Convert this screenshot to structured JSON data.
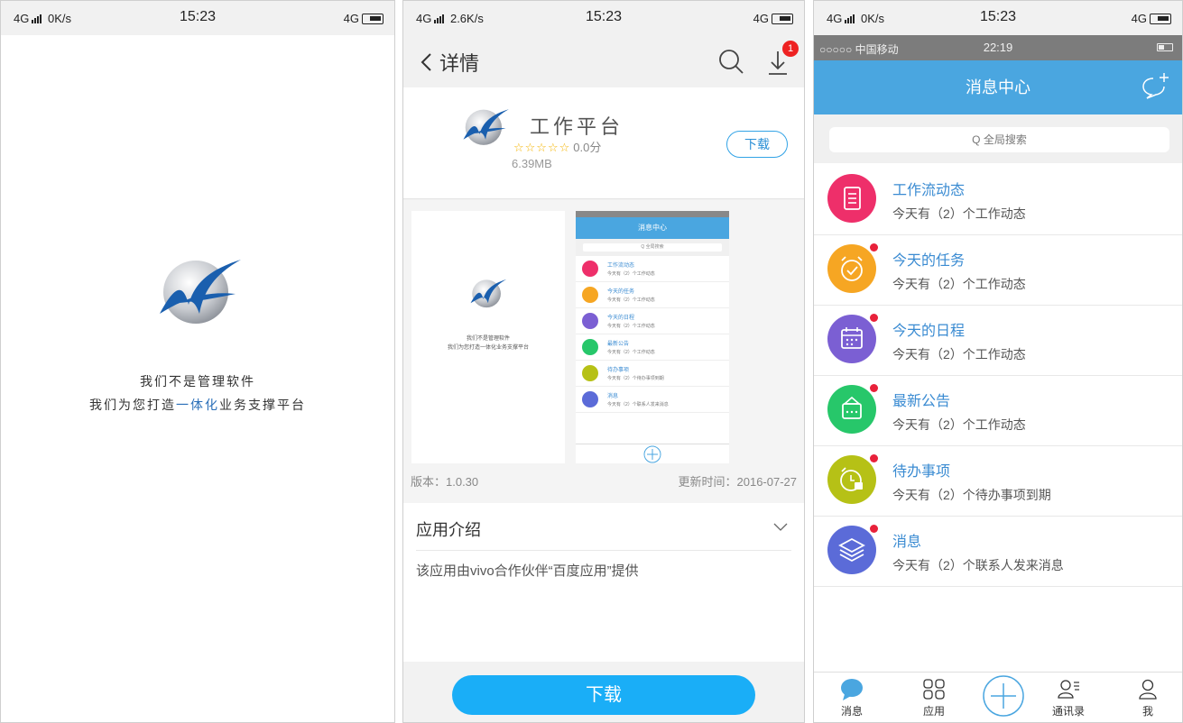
{
  "panel1": {
    "status": {
      "network": "4G",
      "speed": "0K/s",
      "time": "15:23",
      "right_net": "4G"
    },
    "slogan_line1": "我们不是管理软件",
    "slogan_line2_pre": "我们为您打造",
    "slogan_line2_hl": "一体化",
    "slogan_line2_post": "业务支撑平台"
  },
  "panel2": {
    "status": {
      "network": "4G",
      "speed": "2.6K/s",
      "time": "15:23",
      "right_net": "4G"
    },
    "header": {
      "title": "详情",
      "badge": "1"
    },
    "app": {
      "name": "工作平台",
      "stars": "☆☆☆☆☆",
      "rating": "0.0分",
      "size": "6.39MB",
      "download_label": "下载"
    },
    "screenshot_mini": {
      "title": "消息中心",
      "search": "Q 全局搜索",
      "rows": [
        {
          "title": "工作流动态",
          "sub": "今天有（2）个工作动态",
          "color": "#ee2f6a"
        },
        {
          "title": "今天的任务",
          "sub": "今天有（2）个工作动态",
          "color": "#f6a623"
        },
        {
          "title": "今天的日程",
          "sub": "今天有（2）个工作动态",
          "color": "#7b5fd3"
        },
        {
          "title": "最新公告",
          "sub": "今天有（2）个工作动态",
          "color": "#27c76a"
        },
        {
          "title": "待办事项",
          "sub": "今天有（2）个待办事项到期",
          "color": "#b6c116"
        },
        {
          "title": "消息",
          "sub": "今天有（2）个联系人发来消息",
          "color": "#5b6bd8"
        }
      ],
      "slogan_line1": "我们不是管理软件",
      "slogan_line2": "我们为您打造一体化业务支撑平台"
    },
    "version": "版本：1.0.30",
    "updated": "更新时间：2016-07-27",
    "intro_title": "应用介绍",
    "intro_text": "该应用由vivo合作伙伴“百度应用”提供",
    "download_big": "下载"
  },
  "panel3": {
    "status": {
      "network": "4G",
      "speed": "0K/s",
      "time": "15:23",
      "right_net": "4G"
    },
    "ios_status": {
      "carrier": "○○○○○ 中国移动",
      "time": "22:19"
    },
    "header_title": "消息中心",
    "search_placeholder": "Q 全局搜索",
    "items": [
      {
        "title": "工作流动态",
        "sub": "今天有（2）个工作动态",
        "color": "#ee2f6a",
        "icon": "document-icon",
        "dot": false
      },
      {
        "title": "今天的任务",
        "sub": "今天有（2）个工作动态",
        "color": "#f6a623",
        "icon": "alarm-check-icon",
        "dot": true
      },
      {
        "title": "今天的日程",
        "sub": "今天有（2）个工作动态",
        "color": "#7b5fd3",
        "icon": "calendar-icon",
        "dot": true
      },
      {
        "title": "最新公告",
        "sub": "今天有（2）个工作动态",
        "color": "#27c76a",
        "icon": "announcement-icon",
        "dot": true
      },
      {
        "title": "待办事项",
        "sub": "今天有（2）个待办事项到期",
        "color": "#b6c116",
        "icon": "alarm-clock-icon",
        "dot": true
      },
      {
        "title": "消息",
        "sub": "今天有（2）个联系人发来消息",
        "color": "#5b6bd8",
        "icon": "layers-icon",
        "dot": true
      }
    ],
    "tabs": [
      {
        "label": "消息",
        "icon": "chat-bubble-icon"
      },
      {
        "label": "应用",
        "icon": "grid-icon"
      },
      {
        "label": "",
        "icon": "plus-circle-icon"
      },
      {
        "label": "通讯录",
        "icon": "contacts-icon"
      },
      {
        "label": "我",
        "icon": "person-icon"
      }
    ]
  }
}
